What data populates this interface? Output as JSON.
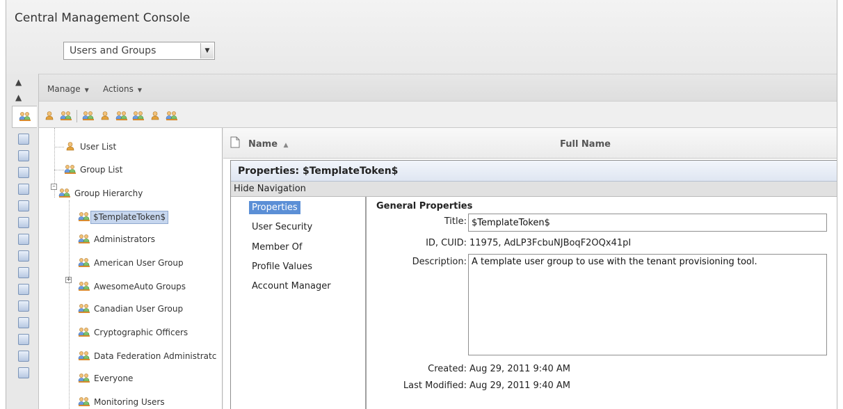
{
  "app": {
    "title": "Central Management Console"
  },
  "view_select": {
    "value": "Users and Groups"
  },
  "menu": {
    "manage": "Manage",
    "actions": "Actions"
  },
  "tree": {
    "items": [
      {
        "label": "User List"
      },
      {
        "label": "Group List"
      },
      {
        "label": "Group Hierarchy"
      },
      {
        "label": "$TemplateToken$"
      },
      {
        "label": "Administrators"
      },
      {
        "label": "American User Group"
      },
      {
        "label": "AwesomeAuto Groups"
      },
      {
        "label": "Canadian User Group"
      },
      {
        "label": "Cryptographic Officers"
      },
      {
        "label": "Data Federation Administratc"
      },
      {
        "label": "Everyone"
      },
      {
        "label": "Monitoring Users"
      }
    ]
  },
  "columns": {
    "name": "Name",
    "full_name": "Full Name"
  },
  "properties": {
    "window_title": "Properties: $TemplateToken$",
    "hide_navigation": "Hide Navigation",
    "nav": [
      "Properties",
      "User Security",
      "Member Of",
      "Profile Values",
      "Account Manager"
    ],
    "section_title": "General Properties",
    "title_label": "Title:",
    "title_value": "$TemplateToken$",
    "id_label": "ID, CUID:",
    "id_value": "11975, AdLP3FcbuNJBoqF2OQx41pI",
    "description_label": "Description:",
    "description_value": "A template user group to use with the tenant provisioning tool.",
    "created_label": "Created:",
    "created_value": "Aug 29, 2011 9:40 AM",
    "modified_label": "Last Modified:",
    "modified_value": "Aug 29, 2011 9:40 AM"
  },
  "colors": {
    "selected_nav": "#5b8fd6",
    "tree_selected": "#c6d6ee",
    "title_band": "#dfe6f2"
  }
}
